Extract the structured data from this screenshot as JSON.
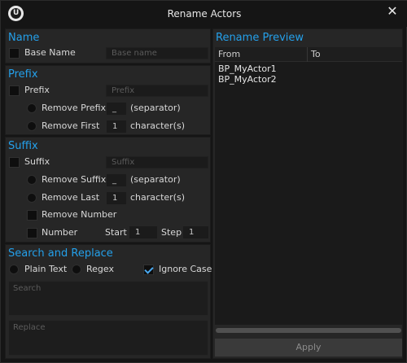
{
  "window": {
    "title": "Rename Actors",
    "logo_letter": "U"
  },
  "name_section": {
    "title": "Name",
    "base_name_label": "Base Name",
    "base_name_placeholder": "Base name"
  },
  "prefix_section": {
    "title": "Prefix",
    "prefix_label": "Prefix",
    "prefix_placeholder": "Prefix",
    "remove_prefix_label": "Remove Prefix",
    "remove_prefix_value": "_",
    "separator_label": "(separator)",
    "remove_first_label": "Remove First",
    "remove_first_value": "1",
    "characters_label": "character(s)"
  },
  "suffix_section": {
    "title": "Suffix",
    "suffix_label": "Suffix",
    "suffix_placeholder": "Suffix",
    "remove_suffix_label": "Remove Suffix",
    "remove_suffix_value": "_",
    "separator_label": "(separator)",
    "remove_last_label": "Remove Last",
    "remove_last_value": "1",
    "characters_label": "character(s)",
    "remove_number_label": "Remove Number",
    "number_label": "Number",
    "start_label": "Start",
    "start_value": "1",
    "step_label": "Step",
    "step_value": "1"
  },
  "search_section": {
    "title": "Search and Replace",
    "plain_text_label": "Plain Text",
    "regex_label": "Regex",
    "ignore_case_label": "Ignore Case",
    "ignore_case_checked": true,
    "search_placeholder": "Search",
    "replace_placeholder": "Replace"
  },
  "preview": {
    "title": "Rename Preview",
    "columns": [
      "From",
      "To"
    ],
    "rows": [
      {
        "from": "BP_MyActor1",
        "to": ""
      },
      {
        "from": "BP_MyActor2",
        "to": ""
      }
    ],
    "apply_label": "Apply"
  }
}
